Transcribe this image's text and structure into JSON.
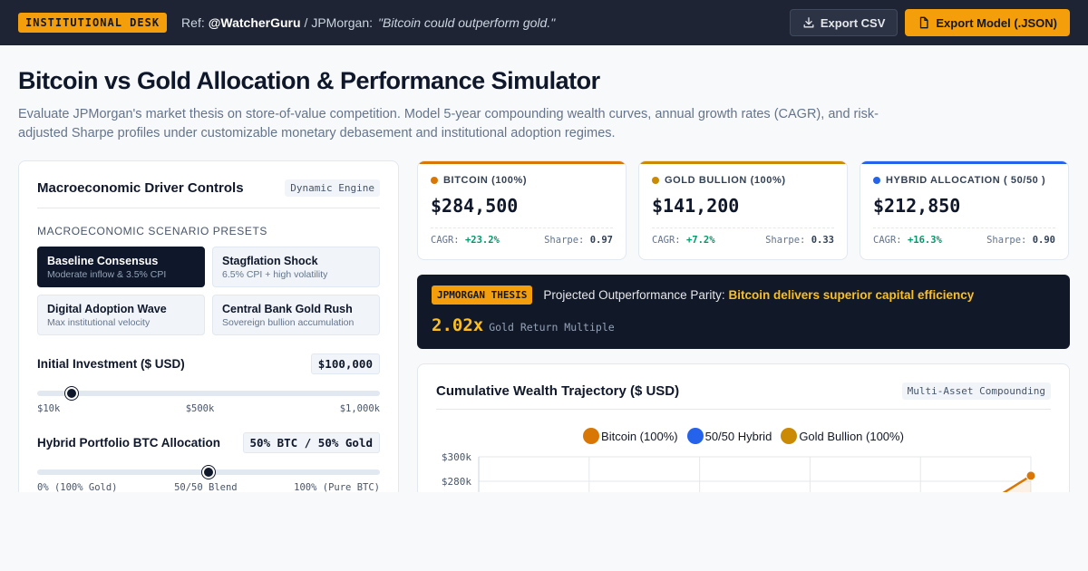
{
  "topbar": {
    "desk_badge": "INSTITUTIONAL DESK",
    "ref_prefix": "Ref:",
    "ref_handle": "@WatcherGuru",
    "ref_sep": "/ JPMorgan:",
    "ref_quote": "\"Bitcoin could outperform gold.\"",
    "export_csv": "Export CSV",
    "export_model": "Export Model (.JSON)"
  },
  "page": {
    "title": "Bitcoin vs Gold Allocation & Performance Simulator",
    "subtitle": "Evaluate JPMorgan's market thesis on store-of-value competition. Model 5-year compounding wealth curves, annual growth rates (CAGR), and risk-adjusted Sharpe profiles under customizable monetary debasement and institutional adoption regimes."
  },
  "controls": {
    "title": "Macroeconomic Driver Controls",
    "engine_tag": "Dynamic Engine",
    "presets_label": "MACROECONOMIC SCENARIO PRESETS",
    "presets": [
      {
        "name": "Baseline Consensus",
        "desc": "Moderate inflow & 3.5% CPI",
        "active": true
      },
      {
        "name": "Stagflation Shock",
        "desc": "6.5% CPI + high volatility",
        "active": false
      },
      {
        "name": "Digital Adoption Wave",
        "desc": "Max institutional velocity",
        "active": false
      },
      {
        "name": "Central Bank Gold Rush",
        "desc": "Sovereign bullion accumulation",
        "active": false
      }
    ],
    "investment": {
      "label": "Initial Investment ($ USD)",
      "value": "$100,000",
      "level": 0.1,
      "ticks": [
        "$10k",
        "$500k",
        "$1,000k"
      ]
    },
    "allocation": {
      "label": "Hybrid Portfolio BTC Allocation",
      "value": "50% BTC / 50% Gold",
      "level": 0.5,
      "ticks": [
        "0% (100% Gold)",
        "50/50 Blend",
        "100% (Pure BTC)"
      ]
    }
  },
  "kpis": [
    {
      "label": "BITCOIN (100%)",
      "value": "$284,500",
      "cagr_label": "CAGR:",
      "cagr": "+23.2%",
      "sharpe_label": "Sharpe:",
      "sharpe": "0.97",
      "color": "#d97706"
    },
    {
      "label": "GOLD BULLION (100%)",
      "value": "$141,200",
      "cagr_label": "CAGR:",
      "cagr": "+7.2%",
      "sharpe_label": "Sharpe:",
      "sharpe": "0.33",
      "color": "#ca8a04"
    },
    {
      "label": "HYBRID ALLOCATION ( 50/50 )",
      "value": "$212,850",
      "cagr_label": "CAGR:",
      "cagr": "+16.3%",
      "sharpe_label": "Sharpe:",
      "sharpe": "0.90",
      "color": "#2563eb"
    }
  ],
  "thesis": {
    "badge": "JPMORGAN THESIS",
    "text": "Projected Outperformance Parity:",
    "highlight": "Bitcoin delivers superior capital efficiency",
    "multiple": "2.02x",
    "multiple_label": "Gold Return Multiple"
  },
  "chart": {
    "title": "Cumulative Wealth Trajectory ($ USD)",
    "tag": "Multi-Asset Compounding"
  },
  "chart_data": {
    "type": "line",
    "title": "Cumulative Wealth Trajectory ($ USD)",
    "series": [
      {
        "name": "Bitcoin (100%)",
        "color": "#d97706"
      },
      {
        "name": "50/50 Hybrid",
        "color": "#2563eb"
      },
      {
        "name": "Gold Bullion (100%)",
        "color": "#ca8a04"
      }
    ],
    "y_ticks": [
      "$300k",
      "$280k"
    ],
    "ylim_visible": [
      260000,
      300000
    ],
    "visible_points": [
      {
        "series": "Bitcoin (100%)",
        "x_index": 5,
        "y": 284500
      }
    ],
    "grid": true
  },
  "colors": {
    "accent": "#f59e0b",
    "dark": "#1e2433",
    "bitcoin": "#d97706",
    "gold": "#ca8a04",
    "hybrid": "#2563eb",
    "positive": "#059669"
  },
  "icons": {
    "export_csv": "download-icon",
    "export_model": "file-icon"
  }
}
